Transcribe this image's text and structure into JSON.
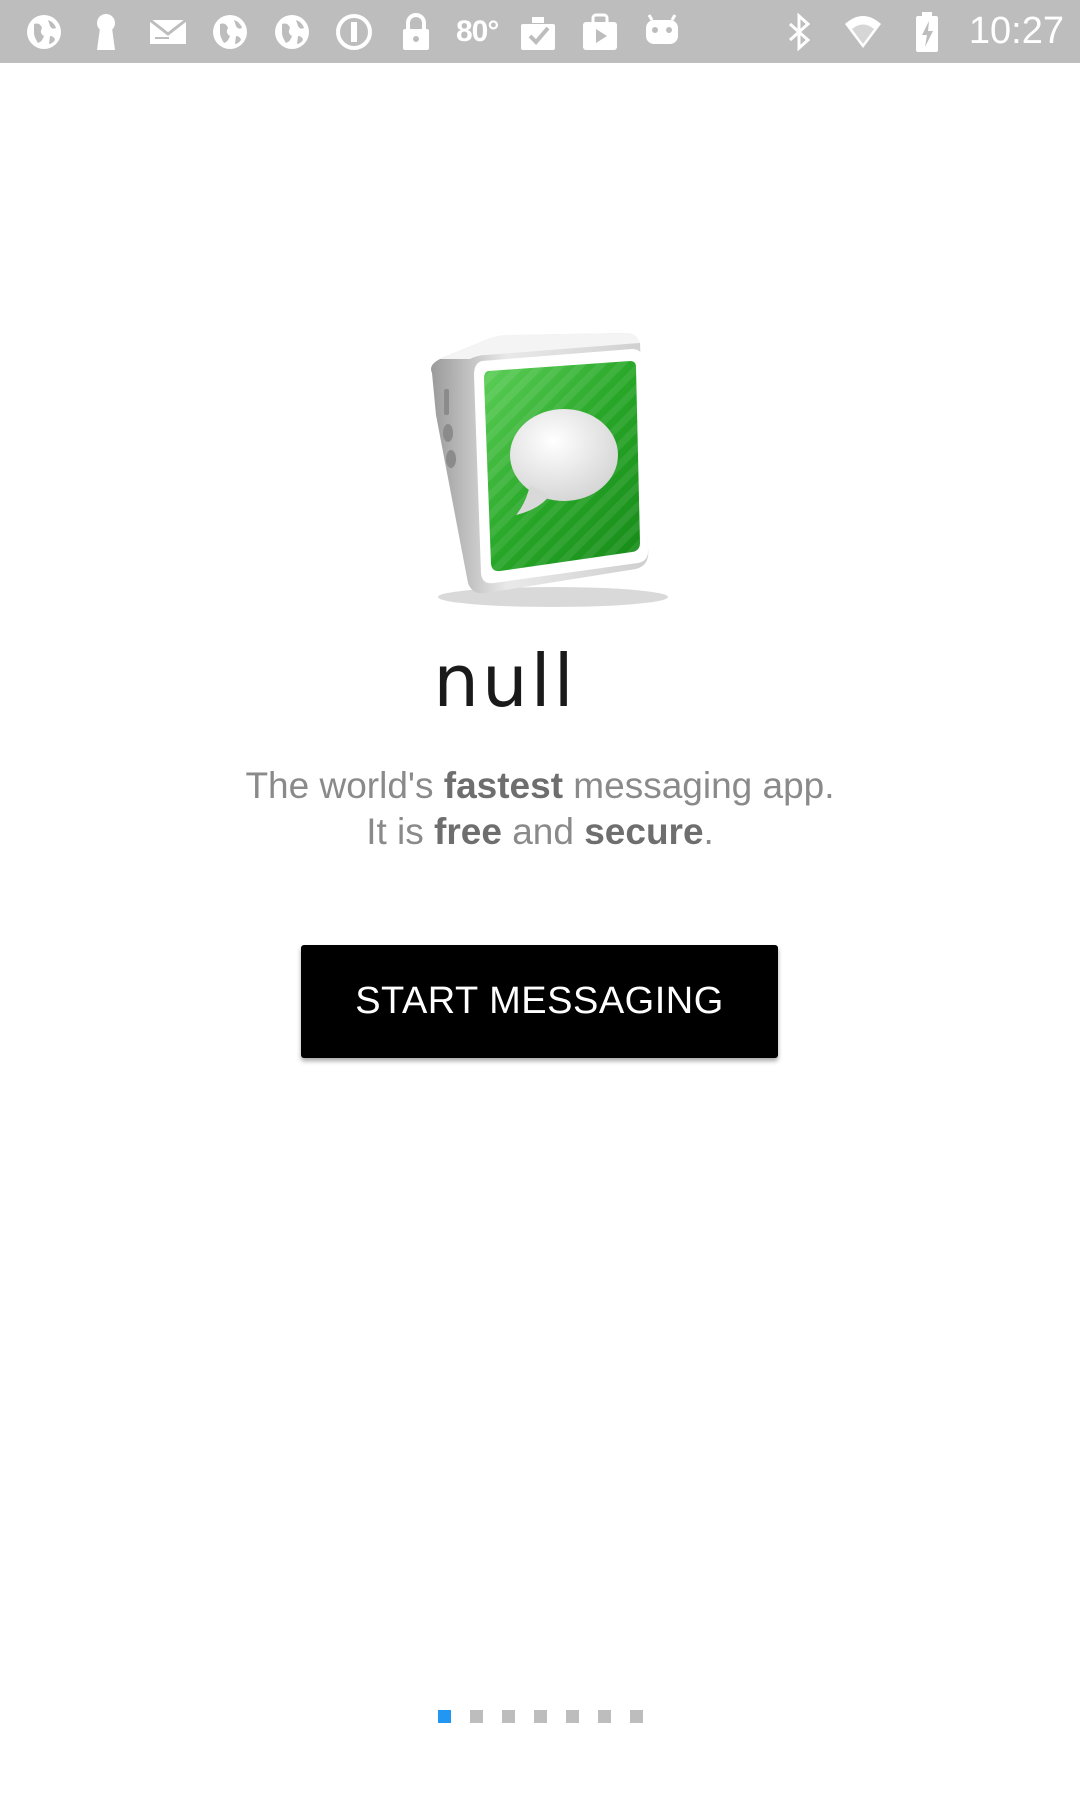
{
  "status_bar": {
    "left_icons": [
      "globe-icon",
      "keyhole-icon",
      "mail-icon",
      "globe-icon",
      "globe-icon",
      "circle-info-icon",
      "lock-icon"
    ],
    "temperature": "80°",
    "middle_icons": [
      "clipboard-check-icon",
      "play-store-icon",
      "android-icon"
    ],
    "right_icons": [
      "bluetooth-icon",
      "wifi-icon",
      "battery-charging-icon"
    ],
    "time": "10:27"
  },
  "app": {
    "logo_icon": "messaging-phone-icon",
    "title": "null",
    "tagline": {
      "line1_pre": "The world's ",
      "line1_bold": "fastest",
      "line1_post": " messaging app.",
      "line2_pre": "It is ",
      "line2_bold1": "free",
      "line2_mid": " and ",
      "line2_bold2": "secure",
      "line2_post": "."
    },
    "start_button_label": "START MESSAGING"
  },
  "page_indicator": {
    "count": 7,
    "active_index": 0,
    "active_color": "#2196f3",
    "inactive_color": "#bdbdbd"
  }
}
